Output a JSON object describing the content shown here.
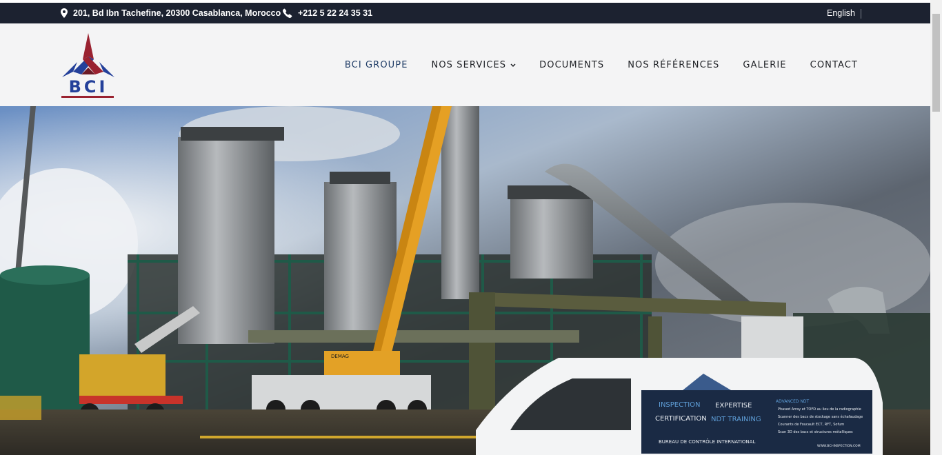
{
  "topbar": {
    "address": "201, Bd Ibn Tachefine, 20300 Casablanca, Morocco",
    "phone": "+212 5 22 24 35 31",
    "language": "English"
  },
  "brand": {
    "logo_text": "BCI",
    "colors": {
      "blue": "#24409a",
      "red": "#9a2230"
    }
  },
  "nav": {
    "items": [
      {
        "label": "BCI GROUPE",
        "active": true
      },
      {
        "label": "NOS SERVICES",
        "has_dropdown": true
      },
      {
        "label": "DOCUMENTS"
      },
      {
        "label": "NOS RÉFÉRENCES"
      },
      {
        "label": "GALERIE"
      },
      {
        "label": "CONTACT"
      }
    ]
  },
  "hero": {
    "van_panel": {
      "left_col": [
        "INSPECTION",
        "CERTIFICATION"
      ],
      "right_col": [
        "EXPERTISE",
        "NDT TRAINING"
      ],
      "footer": "BUREAU DE CONTRÔLE INTERNATIONAL",
      "advanced_title": "ADVANCED NDT",
      "advanced_lines": [
        "Phased Array et TOFD au lieu de la radiographie",
        "Scanner des bacs de stockage sans échafaudage",
        "Courants de Foucault ECT, RFT, Sofum",
        "Scan 3D des bacs et structures métalliques"
      ],
      "website": "WWW.BCI-INSPECTION.COM"
    },
    "crane_brand": "DEMAG"
  }
}
